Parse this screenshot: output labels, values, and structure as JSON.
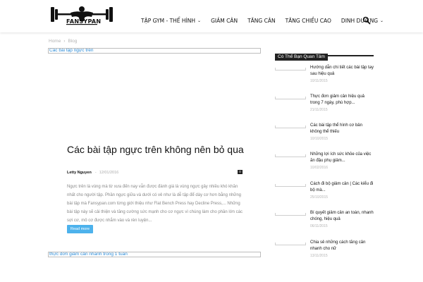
{
  "brand": {
    "logo_text": "FANSYPAN",
    "logo_icon": "barbell-bodybuilder-logo"
  },
  "nav": {
    "items": [
      {
        "label": "Tập Gym - Thể hình",
        "has_dropdown": true
      },
      {
        "label": "Giảm cân",
        "has_dropdown": false
      },
      {
        "label": "Tăng cân",
        "has_dropdown": false
      },
      {
        "label": "Tăng chiều cao",
        "has_dropdown": false
      },
      {
        "label": "Dinh dưỡng",
        "has_dropdown": true
      }
    ],
    "search_icon": "search-icon"
  },
  "breadcrumb": {
    "items": [
      "Home",
      "Blog"
    ],
    "separator": "›"
  },
  "main": {
    "image_link_1": "Các bài tập ngực trên",
    "post": {
      "title": "Các bài tập ngực trên không nên bỏ qua",
      "author": "Letty Nguyen",
      "dash": "-",
      "date": "12/01/2016",
      "comments": "0",
      "excerpt": "Ngực trên là vùng mà từ xưa đến nay vẫn được đánh giá là vùng ngực gây nhiều khó khăn nhất cho người tập. Phần ngực giữa và dưới có vẻ như là dễ tập để dày cơ hơn bằng những bài tập mà Fansypan.com từng giới thiệu như Flat Bench Press hay Decline Press,... Những bài tập này sẽ cải thiện và tăng cường sức mạnh cho cơ ngực vì chúng làm cho phần lớn các sợi cơ, mô cơ được nhắm vào và rèn luyện...",
      "read_more": "Read more"
    },
    "image_link_2": "thực đơn giảm cân nhanh trong 1 tuần"
  },
  "sidebar": {
    "header": "Có Thể Bạn Quan Tâm",
    "items": [
      {
        "title": "Hướng dẫn chi tiết các bài tập tay sau hiệu quả",
        "date": "10/11/2015"
      },
      {
        "title": "Thực đơn giảm cân hiệu quả trong 7 ngày, phù hợp...",
        "date": "21/11/2015"
      },
      {
        "title": "Các bài tập thể hình cơ bản không thể thiếu",
        "date": "10/10/2015"
      },
      {
        "title": "Những lợi ích sức khỏe của việc ăn đậu phụ giảm...",
        "date": "10/02/2016"
      },
      {
        "title": "Cách đi bộ giảm cân | Các kiểu đi bộ mà...",
        "date": "25/10/2015"
      },
      {
        "title": "Bí quyết giảm cân an toàn, nhanh chóng, hiệu quả",
        "date": "06/11/2015"
      },
      {
        "title": "Chia sẻ những cách tăng cân nhanh cho nữ",
        "date": "13/11/2015"
      }
    ]
  }
}
